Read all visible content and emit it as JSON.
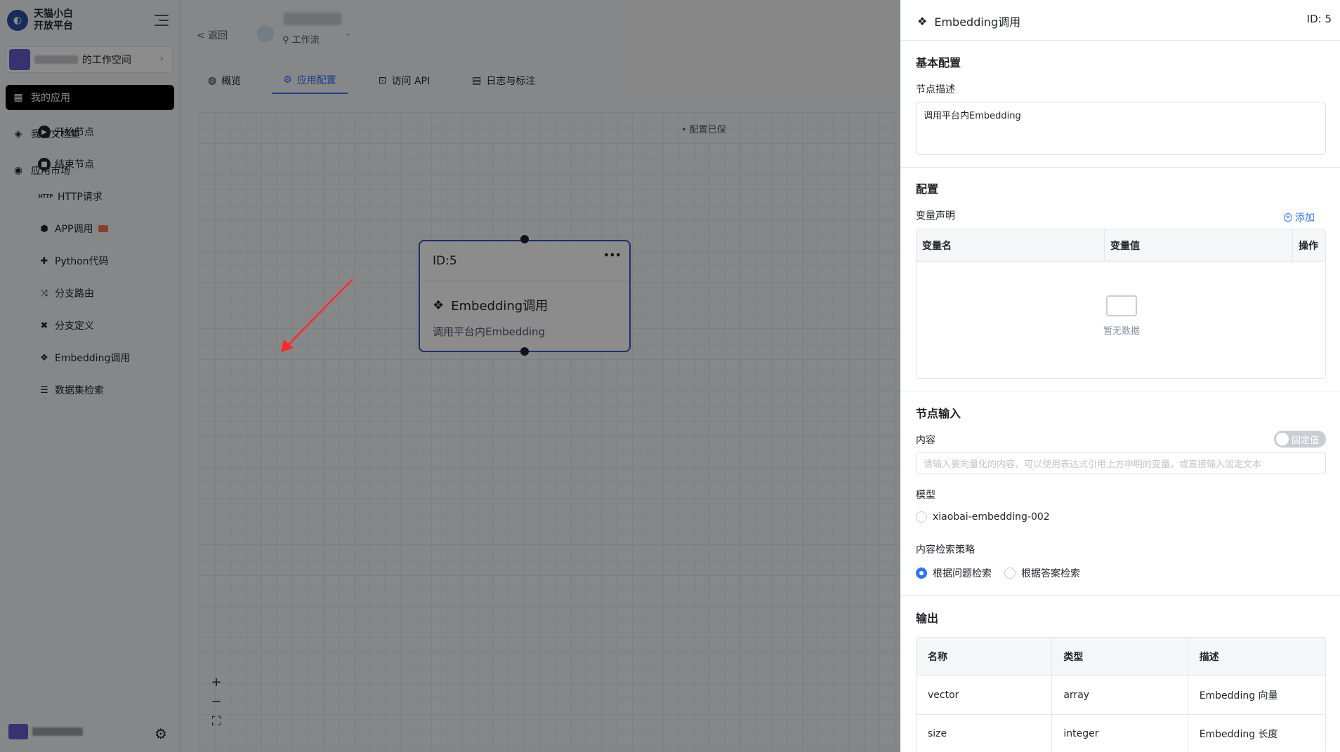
{
  "sidebar": {
    "logo_line1": "天猫小白",
    "logo_line2": "开放平台",
    "workspace_name": "的工作空间",
    "nav": [
      {
        "label": "我的应用",
        "icon": "grid-icon",
        "active": true
      },
      {
        "label": "我的文档集",
        "icon": "layers-icon",
        "active": false
      },
      {
        "label": "应用市场",
        "icon": "compass-icon",
        "active": false
      }
    ]
  },
  "header": {
    "back_label": "返回",
    "app_type": "工作流"
  },
  "tabs": [
    {
      "label": "概览",
      "icon": "overview-icon",
      "active": false
    },
    {
      "label": "应用配置",
      "icon": "config-icon",
      "active": true
    },
    {
      "label": "访问 API",
      "icon": "api-icon",
      "active": false
    },
    {
      "label": "日志与标注",
      "icon": "log-icon",
      "active": false
    }
  ],
  "canvas": {
    "saved_hint": "• 配置已保",
    "palette": [
      {
        "label": "开始节点",
        "icon": "play-icon"
      },
      {
        "label": "结束节点",
        "icon": "stop-icon"
      },
      {
        "label": "HTTP请求",
        "icon": "http-icon"
      },
      {
        "label": "APP调用",
        "icon": "cube-icon"
      },
      {
        "label": "Python代码",
        "icon": "python-icon"
      },
      {
        "label": "分支路由",
        "icon": "branch-icon"
      },
      {
        "label": "分支定义",
        "icon": "tools-icon"
      },
      {
        "label": "Embedding调用",
        "icon": "embedding-icon"
      },
      {
        "label": "数据集检索",
        "icon": "database-icon"
      }
    ],
    "node": {
      "id_label": "ID:5",
      "title": "Embedding调用",
      "description": "调用平台内Embedding"
    }
  },
  "drawer": {
    "title": "Embedding调用",
    "id_label": "ID: 5",
    "basic_section": "基本配置",
    "desc_label": "节点描述",
    "desc_value": "调用平台内Embedding",
    "config_section": "配置",
    "var_label": "变量声明",
    "add_label": "添加",
    "var_columns": [
      "变量名",
      "变量值",
      "操作"
    ],
    "empty_text": "暂无数据",
    "input_section": "节点输入",
    "content_label": "内容",
    "toggle_label": "固定值",
    "content_placeholder": "请输入要向量化的内容，可以使用表达式引用上方申明的变量，或直接输入固定文本",
    "model_label": "模型",
    "model_option": "xiaobai-embedding-002",
    "strategy_label": "内容检索策略",
    "strategy_options": [
      {
        "label": "根据问题检索",
        "checked": true
      },
      {
        "label": "根据答案检索",
        "checked": false
      }
    ],
    "output_section": "输出",
    "output_columns": [
      "名称",
      "类型",
      "描述"
    ],
    "output_rows": [
      {
        "name": "vector",
        "type": "array",
        "desc": "Embedding 向量"
      },
      {
        "name": "size",
        "type": "integer",
        "desc": "Embedding 长度"
      }
    ]
  }
}
